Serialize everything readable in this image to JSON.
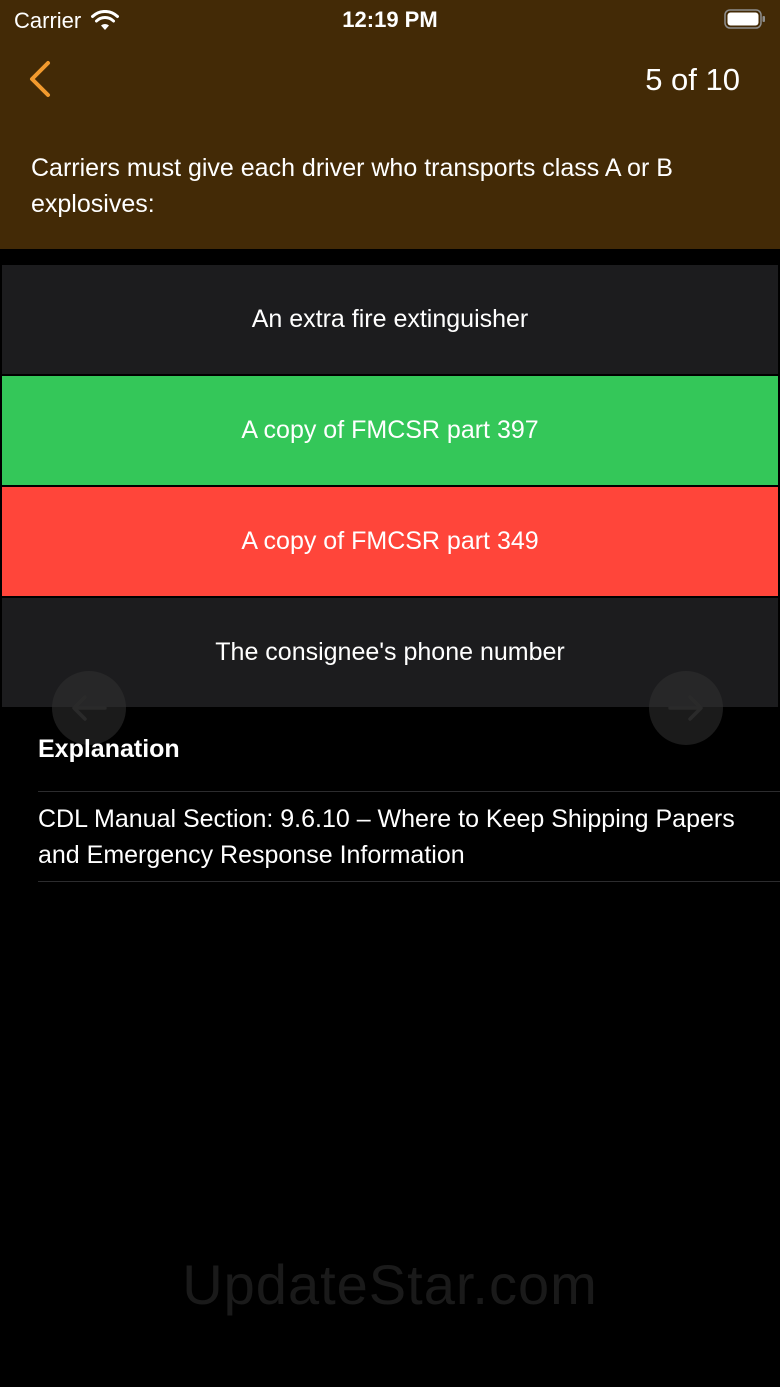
{
  "status_bar": {
    "carrier": "Carrier",
    "time": "12:19 PM"
  },
  "nav": {
    "progress": "5 of 10"
  },
  "question": {
    "text": "Carriers must give each driver who transports class A or B explosives:"
  },
  "answers": [
    {
      "label": "An extra fire extinguisher",
      "state": "neutral"
    },
    {
      "label": "A copy of FMCSR part 397",
      "state": "correct"
    },
    {
      "label": "A copy of FMCSR part 349",
      "state": "wrong"
    },
    {
      "label": "The consignee's phone number",
      "state": "neutral"
    }
  ],
  "explanation": {
    "title": "Explanation",
    "text": "CDL Manual Section: 9.6.10 – Where to Keep Shipping Papers and Emergency Response Information"
  },
  "watermark": "UpdateStar.com",
  "colors": {
    "header_bg": "#432a06",
    "accent": "#f29a2e",
    "correct": "#34c759",
    "wrong": "#ff453a",
    "neutral": "#1c1c1e"
  },
  "icons": {
    "wifi": "wifi-icon",
    "battery": "battery-icon",
    "back": "chevron-left-icon",
    "prev": "arrow-left-icon",
    "next": "arrow-right-icon"
  }
}
